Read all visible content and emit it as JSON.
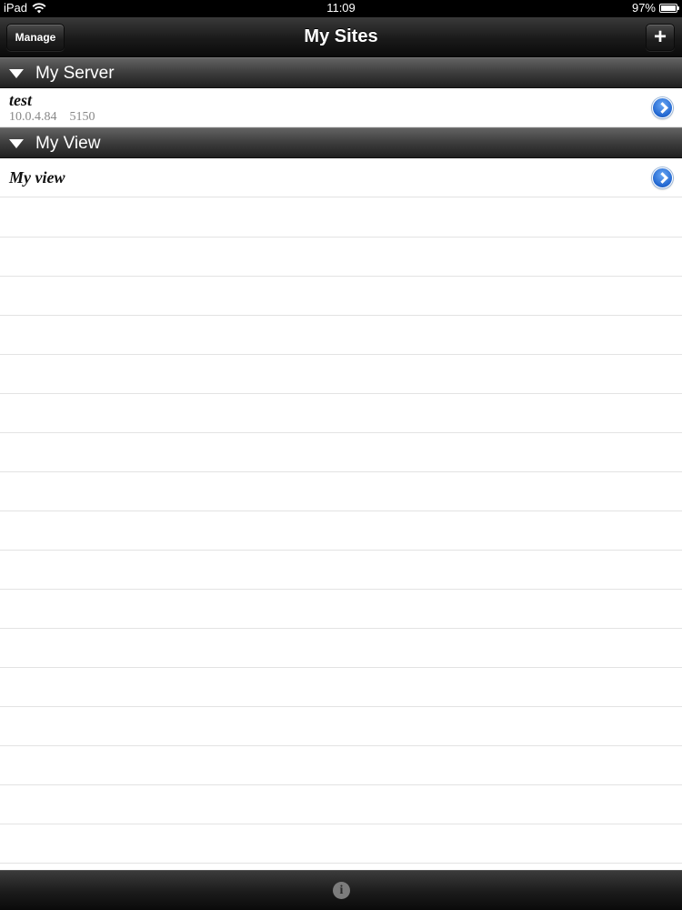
{
  "status_bar": {
    "device": "iPad",
    "time": "11:09",
    "battery": "97%",
    "battery_level": 0.97,
    "wifi_icon": "wifi-icon"
  },
  "nav_bar": {
    "title": "My Sites",
    "manage_label": "Manage",
    "add_label": "+"
  },
  "sections": [
    {
      "title": "My Server",
      "rows": [
        {
          "name": "test",
          "address": "10.0.4.84",
          "port": "5150"
        }
      ]
    },
    {
      "title": "My View",
      "rows": [
        {
          "name": "My view"
        }
      ]
    }
  ],
  "toolbar": {
    "info_icon": "info-icon",
    "info_glyph": "i"
  },
  "colors": {
    "disclosure_blue": "#2166d0",
    "bar_dark": "#1a1a1a"
  }
}
